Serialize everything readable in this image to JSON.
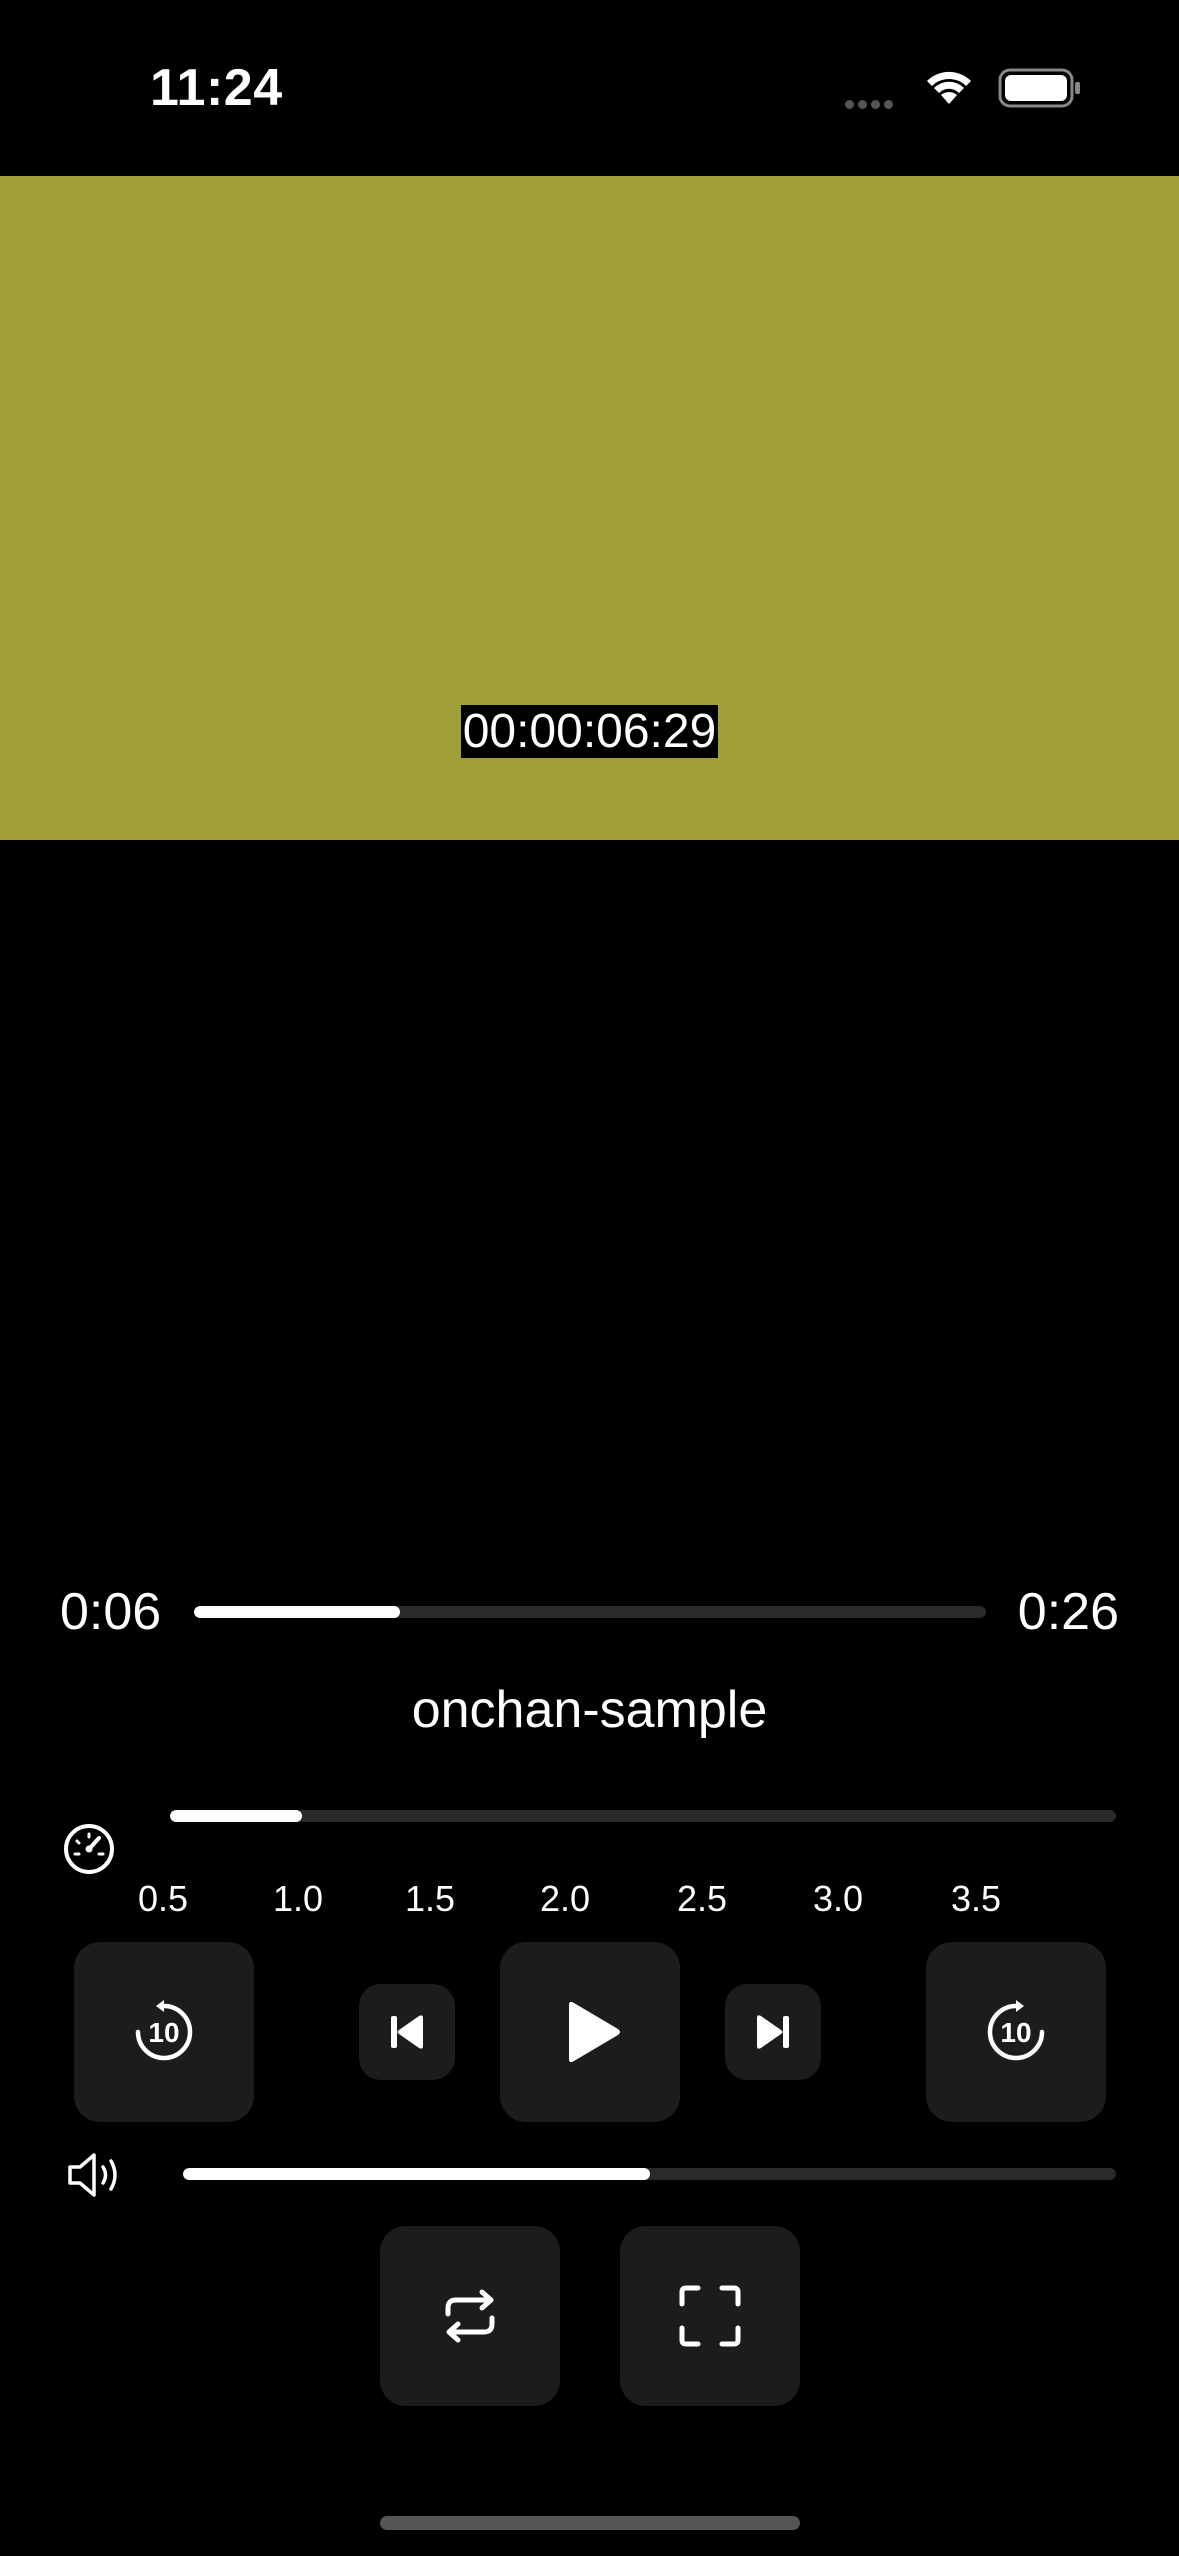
{
  "status_bar": {
    "time": "11:24"
  },
  "video": {
    "timecode": "00:00:06:29",
    "background_color": "#a19f38"
  },
  "playback": {
    "elapsed": "0:06",
    "duration": "0:26",
    "progress_fraction": 0.26,
    "title": "onchan-sample"
  },
  "speed": {
    "ticks": [
      "0.5",
      "1.0",
      "1.5",
      "2.0",
      "2.5",
      "3.0",
      "3.5"
    ],
    "current": "1.0",
    "fill_fraction": 0.14
  },
  "controls": {
    "rewind_icon": "gobackward-10-icon",
    "rewind_seconds": "10",
    "previous_icon": "backward-end-icon",
    "play_icon": "play-icon",
    "next_icon": "forward-end-icon",
    "forward_icon": "goforward-10-icon",
    "forward_seconds": "10",
    "repeat_icon": "repeat-icon",
    "fullscreen_icon": "fullscreen-icon"
  },
  "volume": {
    "level_fraction": 0.5,
    "icon": "speaker-wave-icon"
  },
  "colors": {
    "background": "#000000",
    "button_bg": "#1c1c1e",
    "track_bg": "#2a2a2a",
    "fill": "#ffffff"
  }
}
